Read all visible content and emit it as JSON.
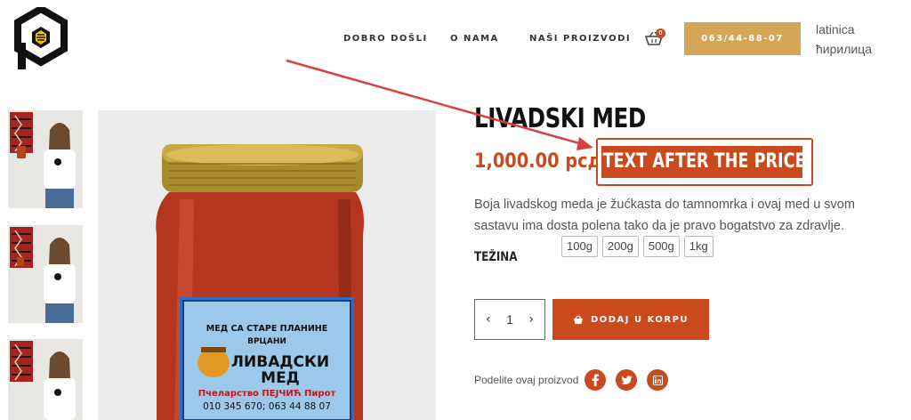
{
  "header": {
    "nav": [
      "DOBRO DOŠLI",
      "O NAMA",
      "NAŠI PROIZVODI"
    ],
    "cart_count": "0",
    "phone": "063/44-88-07",
    "languages": [
      "latinica",
      "ћирилица"
    ]
  },
  "product": {
    "title": "LIVADSKI MED",
    "price": "1,000.00 рсд",
    "price_note": "TEXT AFTER THE PRICE",
    "description": "Boja livadskog meda je žućkasta do tamnomrka i ovaj med u svom sastavu ima dosta polena tako da je pravo bogatstvo za zdravlje.",
    "weight_label": "TEŽINA",
    "weights": [
      "100g",
      "200g",
      "500g",
      "1kg"
    ],
    "quantity": "1",
    "add_to_cart": "DODAJ U KORPU",
    "share_label": "Podelite ovaj proizvod"
  },
  "jar_label": {
    "top": "МЕД СА СТАРЕ ПЛАНИНЕ",
    "sub": "ВРЦАНИ",
    "name_1": "ЛИВАДСКИ",
    "name_2": "МЕД",
    "maker": "Пчеларство ПЕЈЧИЋ Пирот",
    "phones": "010 345 670; 063 44 88 07"
  },
  "colors": {
    "accent": "#c94a1c",
    "gold": "#d4a656"
  },
  "icons": [
    "logo-icon",
    "cart-icon",
    "basket-icon",
    "facebook-icon",
    "twitter-icon",
    "linkedin-icon",
    "chevron-left-icon",
    "chevron-right-icon"
  ]
}
